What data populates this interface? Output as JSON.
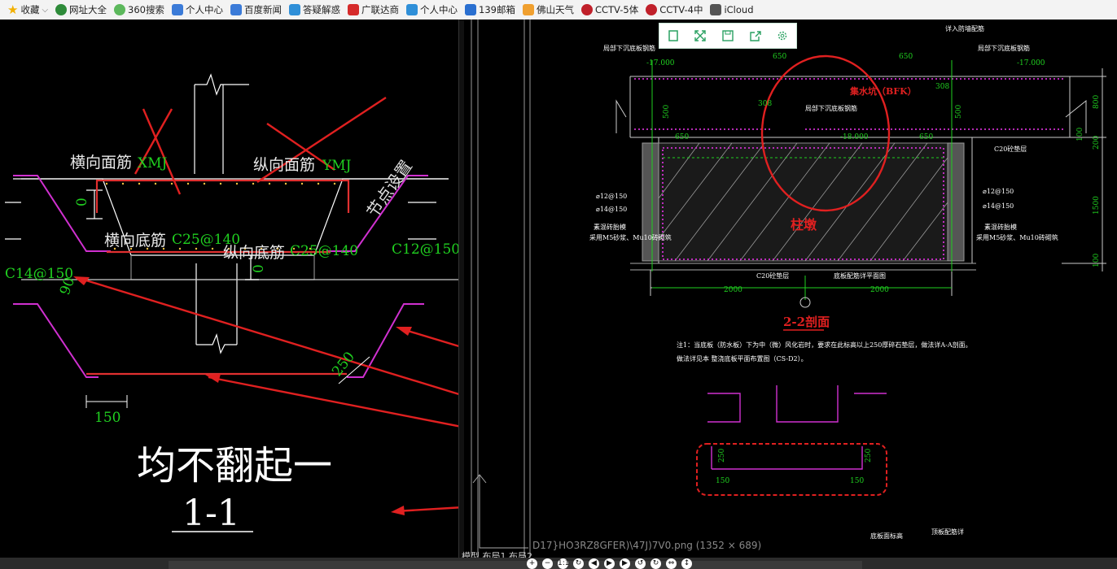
{
  "bookmarks": [
    {
      "label": "收藏",
      "icon": "star-icon",
      "color": "#f2b000",
      "dropdown": "⌵"
    },
    {
      "label": "网址大全",
      "icon": "globe-icon",
      "color": "#2e8b3a"
    },
    {
      "label": "360搜索",
      "icon": "360-icon",
      "color": "#5cb85c"
    },
    {
      "label": "个人中心",
      "icon": "paw-icon",
      "color": "#3b7bd8"
    },
    {
      "label": "百度新闻",
      "icon": "paw-icon",
      "color": "#3b7bd8"
    },
    {
      "label": "答疑解惑",
      "icon": "question-icon",
      "color": "#2f8fd8"
    },
    {
      "label": "广联达商",
      "icon": "g-icon",
      "color": "#d62b2b"
    },
    {
      "label": "个人中心",
      "icon": "question-icon",
      "color": "#2f8fd8"
    },
    {
      "label": "139邮箱",
      "icon": "mail-icon",
      "color": "#2a6fd0"
    },
    {
      "label": "佛山天气",
      "icon": "weather-icon",
      "color": "#f0a030"
    },
    {
      "label": "CCTV-5体",
      "icon": "cctv-icon",
      "color": "#c0202a"
    },
    {
      "label": "CCTV-4中",
      "icon": "cctv-icon",
      "color": "#c0202a"
    },
    {
      "label": "iCloud",
      "icon": "apple-icon",
      "color": "#555"
    }
  ],
  "left_drawing": {
    "label_h_top": "横向面筋",
    "label_h_top_code": "XMJ",
    "label_v_top": "纵向面筋",
    "label_v_top_code": "YMJ",
    "label_h_bottom": "横向底筋",
    "label_h_bottom_code": "C25@140",
    "label_v_bottom": "纵向底筋",
    "label_v_bottom_code": "C25@140",
    "label_node": "节点设置",
    "label_c12": "C12@150",
    "label_c14": "C14@150",
    "dim_0a": "0",
    "dim_0b": "0",
    "dim_90": "90",
    "dim_250": "250",
    "dim_150": "150",
    "caption": "均不翻起一",
    "section": "1-1"
  },
  "right_drawing": {
    "dim_17000_left": "-17.000",
    "dim_17000_right": "-17.000",
    "dim_18000": "-18.000",
    "label_pit": "集水坑（BFK）",
    "label_pile": "柱墩",
    "section_title": "2-2剖面",
    "dim_2000_left": "2000",
    "dim_2000_right": "2000",
    "dim_650_a": "650",
    "dim_650_b": "650",
    "dim_650_c": "650",
    "dim_650_d": "650",
    "dim_500_a": "500",
    "dim_500_b": "500",
    "dim_800": "800",
    "dim_200": "200",
    "dim_1500": "1500",
    "dim_100_a": "100",
    "dim_100_b": "100",
    "dim_308_a": "308",
    "dim_308_b": "308",
    "rebar_12_l": "⌀12@150",
    "rebar_14_l": "⌀14@150",
    "rebar_12_r": "⌀12@150",
    "rebar_14_r": "⌀14@150",
    "label_c20_a": "C20砼垫层",
    "label_c20_b": "C20砼垫层",
    "note_line1": "注1：当底板（防水板）下为中（微）风化岩时，要求在此标高以上250厚碎石垫层，做法详A-A剖面。",
    "note_line2": "做法详见本 整浇底板平面布置图（CS-D2）。",
    "detail_250_a": "250",
    "detail_250_b": "250",
    "detail_150_a": "150",
    "detail_150_b": "150",
    "filename": "D17}HO3RZ8GFER)\\47J)7V0.png (1352 × 689)",
    "tabs": "模型 布局1 布局2",
    "label_top_right": "详入防墙配筋",
    "label_left_small": "局部下沉底板钢筋",
    "label_right_small": "局部下沉底板钢筋",
    "label_mid_small": "局部下沉底板钢筋",
    "label_brick_l1": "素混砖胎模",
    "label_brick_l2": "采用M5砂浆、Mu10砖砌筑",
    "label_brick_r1": "素混砖胎模",
    "label_brick_r2": "采用M5砂浆、Mu10砖砌筑",
    "label_bottom_mid": "底板配筋详平面图",
    "label_br1": "底板面标高",
    "label_br2": "顶板配筋详"
  },
  "toolbar": {
    "buttons": [
      "copy-icon",
      "expand-icon",
      "save-icon",
      "share-icon",
      "settings-icon"
    ]
  },
  "viewer_controls": [
    "+",
    "−",
    "1:1",
    "↻",
    "◀",
    "▶",
    "▶",
    "↺",
    "↻",
    "⇔",
    "↕"
  ]
}
